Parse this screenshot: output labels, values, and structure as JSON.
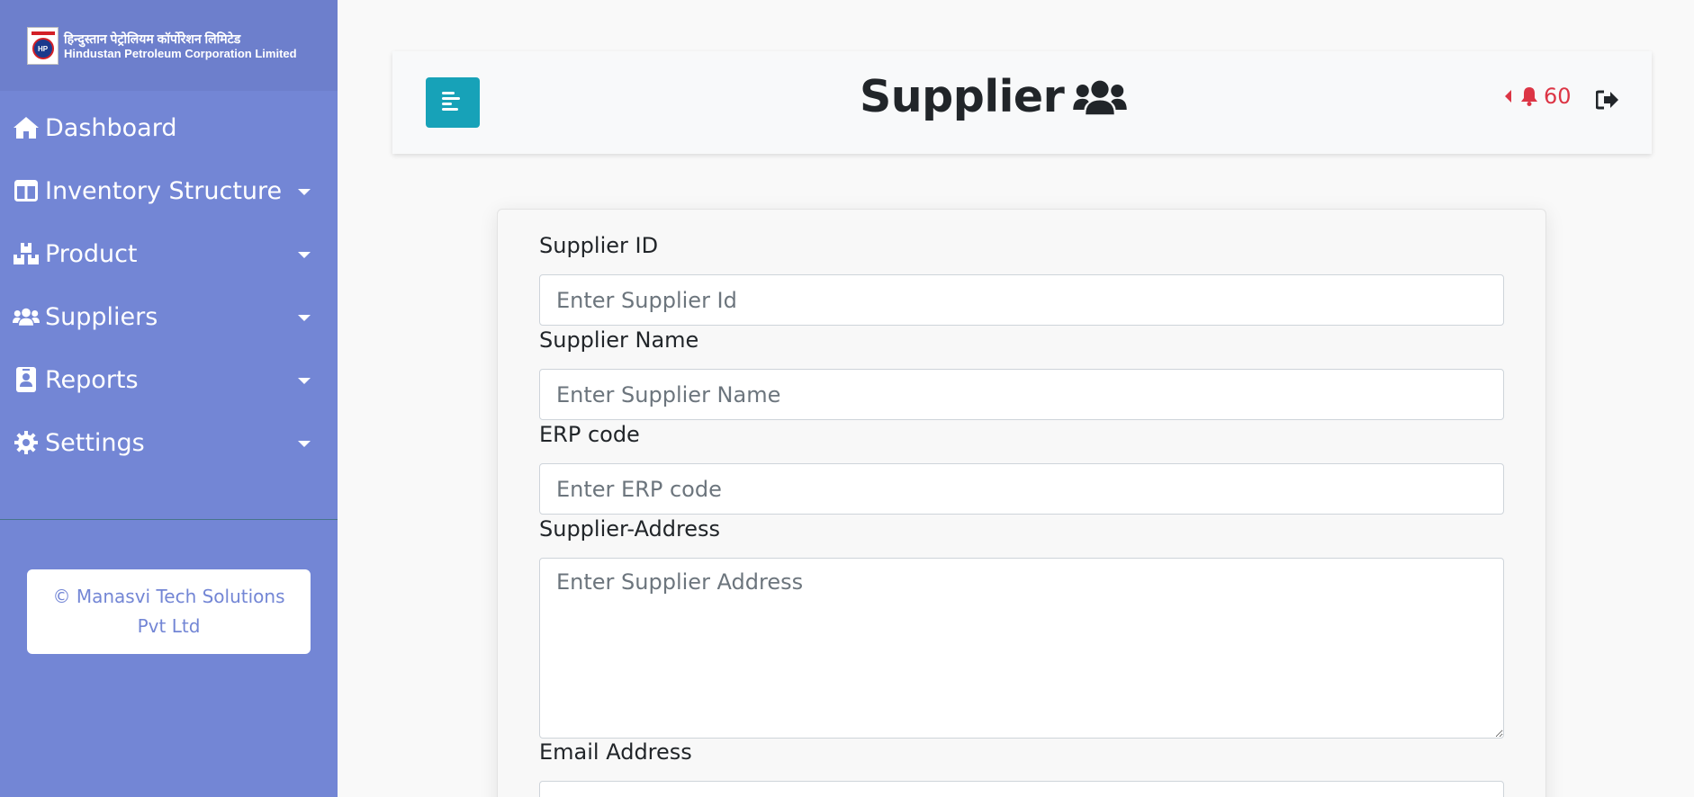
{
  "brand": {
    "hindi_name": "हिन्दुस्तान पेट्रोलियम कॉर्पोरेशन लिमिटेड",
    "english_name": "Hindustan Petroleum Corporation Limited",
    "logo_text": "HP"
  },
  "sidebar": {
    "items": [
      {
        "label": "Dashboard",
        "icon": "home-icon",
        "has_dropdown": false
      },
      {
        "label": "Inventory Structure",
        "icon": "columns-icon",
        "has_dropdown": true
      },
      {
        "label": "Product",
        "icon": "boxes-icon",
        "has_dropdown": true
      },
      {
        "label": "Suppliers",
        "icon": "users-icon",
        "has_dropdown": true
      },
      {
        "label": "Reports",
        "icon": "id-badge-icon",
        "has_dropdown": true
      },
      {
        "label": "Settings",
        "icon": "gear-icon",
        "has_dropdown": true
      }
    ],
    "credit": "© Manasvi Tech Solutions Pvt Ltd"
  },
  "header": {
    "title": "Supplier",
    "title_icon": "users-icon",
    "notification_count": "60",
    "toggle_icon": "align-left-icon",
    "logout_icon": "sign-out-icon"
  },
  "form": {
    "fields": [
      {
        "label": "Supplier ID",
        "placeholder": "Enter Supplier Id",
        "value": ""
      },
      {
        "label": "Supplier Name",
        "placeholder": "Enter Supplier Name",
        "value": ""
      },
      {
        "label": "ERP code",
        "placeholder": "Enter ERP code",
        "value": ""
      },
      {
        "label": "Supplier-Address",
        "placeholder": "Enter Supplier Address",
        "value": ""
      },
      {
        "label": "Email Address",
        "placeholder": "",
        "value": ""
      }
    ]
  },
  "colors": {
    "sidebar_bg": "#7386d5",
    "brand_bg": "#6d7fcc",
    "toggle_button": "#17a2b8",
    "notification": "#dc3545"
  }
}
